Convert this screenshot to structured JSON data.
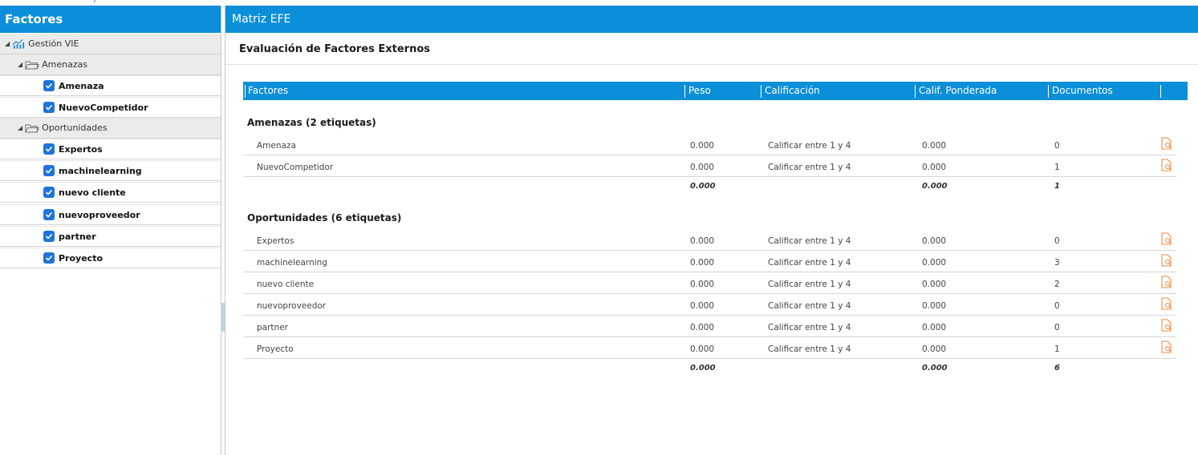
{
  "top_fragment": ")",
  "left_panel": {
    "title": "Factores",
    "root": {
      "label": "Gestión VIE",
      "icon": "chart-folder-icon"
    },
    "groups": [
      {
        "label": "Amenazas",
        "items": [
          "Amenaza",
          "NuevoCompetidor"
        ]
      },
      {
        "label": "Oportunidades",
        "items": [
          "Expertos",
          "machinelearning",
          "nuevo cliente",
          "nuevoproveedor",
          "partner",
          "Proyecto"
        ]
      }
    ]
  },
  "main": {
    "title": "Matriz EFE",
    "subtitle": "Evaluación de Factores Externos",
    "columns": [
      "Factores",
      "Peso",
      "Calificación",
      "Calif. Ponderada",
      "Documentos"
    ],
    "sections": [
      {
        "title": "Amenazas (2 etiquetas)",
        "rows": [
          {
            "factor": "Amenaza",
            "peso": "0.000",
            "calificacion": "Calificar entre 1 y 4",
            "ponderada": "0.000",
            "documentos": "0"
          },
          {
            "factor": "NuevoCompetidor",
            "peso": "0.000",
            "calificacion": "Calificar entre 1 y 4",
            "ponderada": "0.000",
            "documentos": "1"
          }
        ],
        "total": {
          "peso": "0.000",
          "ponderada": "0.000",
          "documentos": "1"
        }
      },
      {
        "title": "Oportunidades (6 etiquetas)",
        "rows": [
          {
            "factor": "Expertos",
            "peso": "0.000",
            "calificacion": "Calificar entre 1 y 4",
            "ponderada": "0.000",
            "documentos": "0"
          },
          {
            "factor": "machinelearning",
            "peso": "0.000",
            "calificacion": "Calificar entre 1 y 4",
            "ponderada": "0.000",
            "documentos": "3"
          },
          {
            "factor": "nuevo cliente",
            "peso": "0.000",
            "calificacion": "Calificar entre 1 y 4",
            "ponderada": "0.000",
            "documentos": "2"
          },
          {
            "factor": "nuevoproveedor",
            "peso": "0.000",
            "calificacion": "Calificar entre 1 y 4",
            "ponderada": "0.000",
            "documentos": "0"
          },
          {
            "factor": "partner",
            "peso": "0.000",
            "calificacion": "Calificar entre 1 y 4",
            "ponderada": "0.000",
            "documentos": "0"
          },
          {
            "factor": "Proyecto",
            "peso": "0.000",
            "calificacion": "Calificar entre 1 y 4",
            "ponderada": "0.000",
            "documentos": "1"
          }
        ],
        "total": {
          "peso": "0.000",
          "ponderada": "0.000",
          "documentos": "6"
        }
      }
    ]
  },
  "colors": {
    "header_blue": "#0b8fd8",
    "checkbox_blue": "#1f73d8",
    "doc_icon_orange": "#f08a3c"
  },
  "icons": {
    "row_action": "document-search-icon",
    "tree_expand": "triangle-expanded-icon",
    "group": "folder-open-icon",
    "check": "checkbox-checked-icon"
  }
}
